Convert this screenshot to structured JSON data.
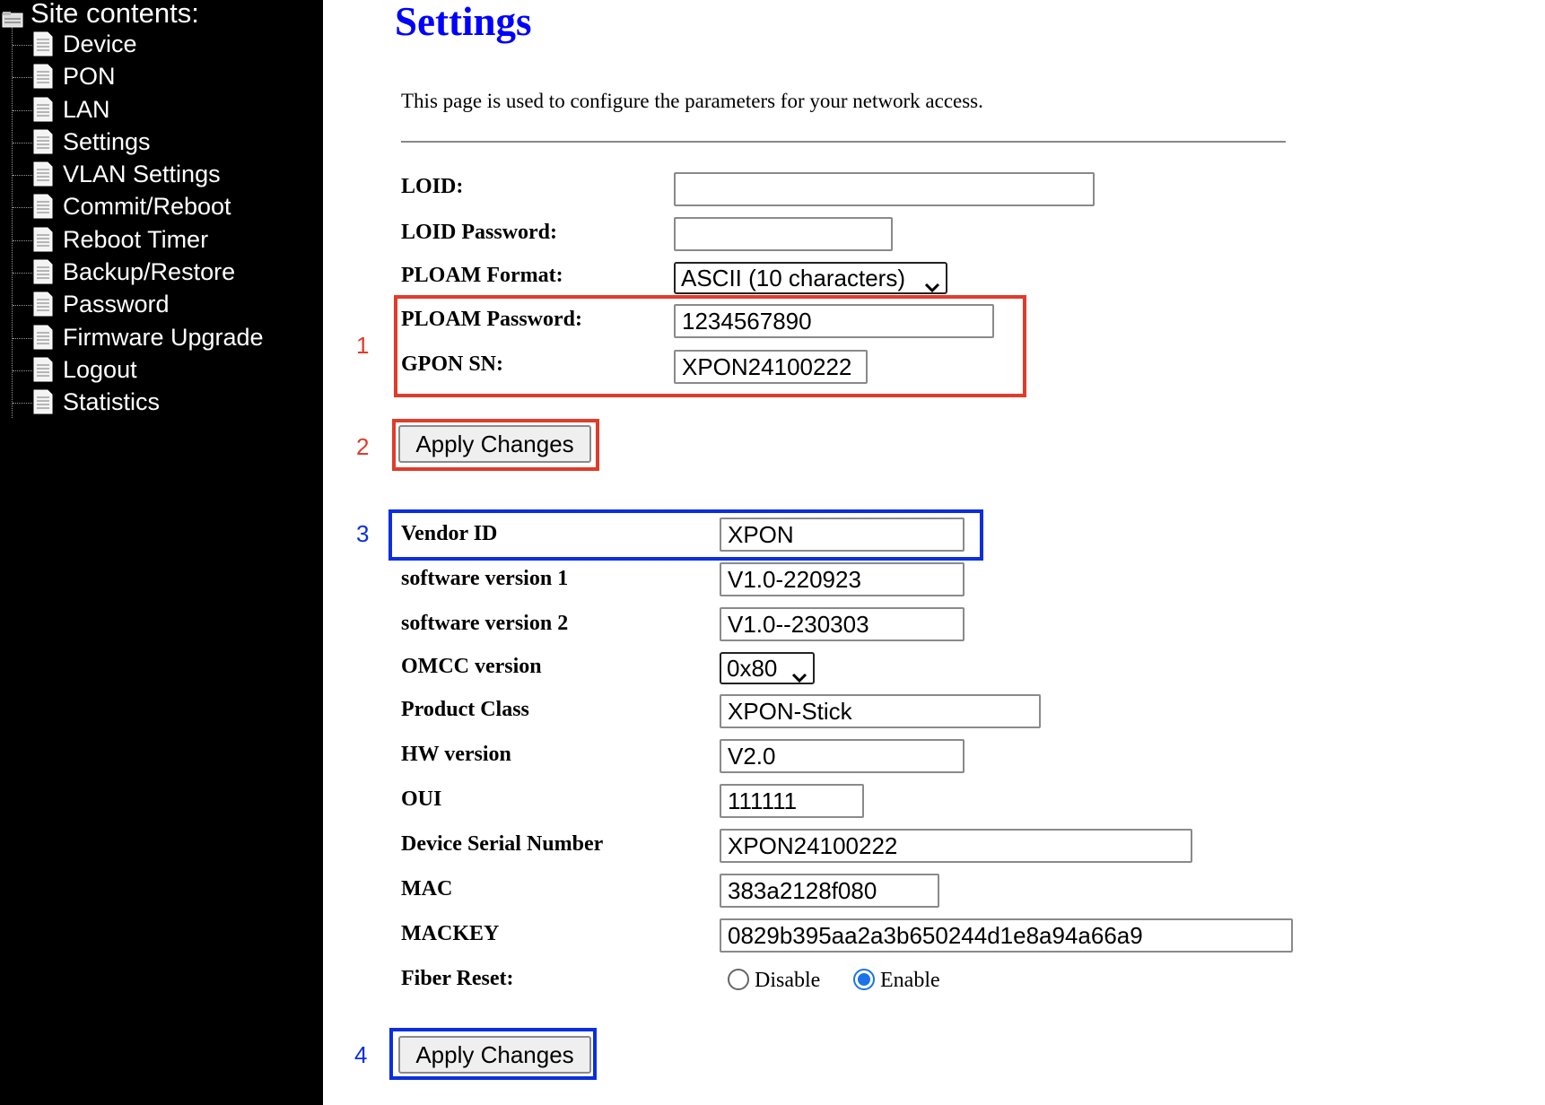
{
  "sidebar": {
    "title": "Site contents:",
    "items": [
      {
        "label": "Device"
      },
      {
        "label": "PON"
      },
      {
        "label": "LAN"
      },
      {
        "label": "Settings"
      },
      {
        "label": "VLAN Settings"
      },
      {
        "label": "Commit/Reboot"
      },
      {
        "label": "Reboot Timer"
      },
      {
        "label": "Backup/Restore"
      },
      {
        "label": "Password"
      },
      {
        "label": "Firmware Upgrade"
      },
      {
        "label": "Logout"
      },
      {
        "label": "Statistics"
      }
    ]
  },
  "page": {
    "title": "Settings",
    "description": "This page is used to configure the parameters for your network access."
  },
  "form1": {
    "loid": {
      "label": "LOID:",
      "value": ""
    },
    "loid_password": {
      "label": "LOID Password:",
      "value": ""
    },
    "ploam_format": {
      "label": "PLOAM Format:",
      "value": "ASCII (10 characters)"
    },
    "ploam_password": {
      "label": "PLOAM Password:",
      "value": "1234567890"
    },
    "gpon_sn": {
      "label": "GPON SN:",
      "value": "XPON24100222"
    },
    "apply_label": "Apply Changes"
  },
  "form2": {
    "vendor_id": {
      "label": "Vendor ID",
      "value": "XPON"
    },
    "sw_version_1": {
      "label": "software version 1",
      "value": "V1.0-220923"
    },
    "sw_version_2": {
      "label": "software version 2",
      "value": "V1.0--230303"
    },
    "omcc_version": {
      "label": "OMCC version",
      "value": "0x80"
    },
    "product_class": {
      "label": "Product Class",
      "value": "XPON-Stick"
    },
    "hw_version": {
      "label": "HW version",
      "value": "V2.0"
    },
    "oui": {
      "label": "OUI",
      "value": "111111"
    },
    "device_sn": {
      "label": "Device Serial Number",
      "value": "XPON24100222"
    },
    "mac": {
      "label": "MAC",
      "value": "383a2128f080"
    },
    "mackey": {
      "label": "MACKEY",
      "value": "0829b395aa2a3b650244d1e8a94a66a9"
    },
    "fiber_reset": {
      "label": "Fiber Reset:",
      "options": [
        "Disable",
        "Enable"
      ],
      "selected": "Enable"
    },
    "apply_label": "Apply Changes"
  },
  "annotations": {
    "n1": "1",
    "n2": "2",
    "n3": "3",
    "n4": "4",
    "red": "#e03c2a",
    "blue": "#0b2ee0"
  }
}
